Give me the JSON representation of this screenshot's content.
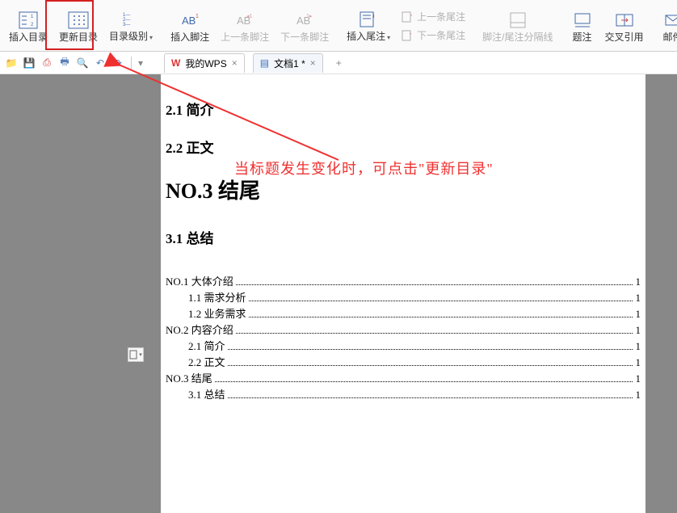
{
  "ribbon": {
    "insert_toc": "插入目录",
    "update_toc": "更新目录",
    "toc_level": "目录级别",
    "insert_footnote": "插入脚注",
    "prev_footnote": "上一条脚注",
    "next_footnote": "下一条脚注",
    "insert_endnote": "插入尾注",
    "prev_endnote": "上一条尾注",
    "next_endnote": "下一条尾注",
    "footnote_endnote_sep": "脚注/尾注分隔线",
    "caption": "题注",
    "cross_ref": "交叉引用",
    "mail": "邮件"
  },
  "tabs": {
    "wps_home": "我的WPS",
    "doc1": "文档1 *"
  },
  "annotation": "当标题发生变化时，可点击\"更新目录\"",
  "doc": {
    "h_21": "2.1 简介",
    "h_22": "2.2 正文",
    "h_no3": "NO.3 结尾",
    "h_31": "3.1 总结",
    "toc": [
      {
        "level": 0,
        "title": "NO.1 大体介绍",
        "page": "1"
      },
      {
        "level": 1,
        "title": "1.1 需求分析",
        "page": "1"
      },
      {
        "level": 1,
        "title": "1.2 业务需求",
        "page": "1"
      },
      {
        "level": 0,
        "title": "NO.2 内容介绍",
        "page": "1"
      },
      {
        "level": 1,
        "title": "2.1 简介",
        "page": "1"
      },
      {
        "level": 1,
        "title": "2.2 正文",
        "page": "1"
      },
      {
        "level": 0,
        "title": "NO.3 结尾",
        "page": "1"
      },
      {
        "level": 1,
        "title": "3.1 总结",
        "page": "1"
      }
    ]
  }
}
